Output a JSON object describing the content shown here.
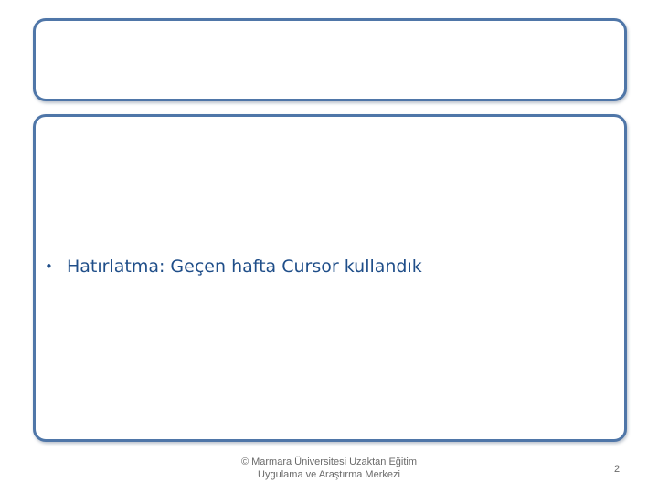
{
  "slide": {
    "bullet_symbol": "•",
    "bullet_text": "Hatırlatma: Geçen hafta Cursor kullandık",
    "footer_line1": "© Marmara Üniversitesi Uzaktan Eğitim",
    "footer_line2": "Uygulama ve Araştırma Merkezi",
    "page_number": "2"
  },
  "colors": {
    "panel_border": "#4f76a8",
    "bullet_text": "#1f4e89",
    "footer_text": "#6b6b6b",
    "background": "#ffffff"
  }
}
